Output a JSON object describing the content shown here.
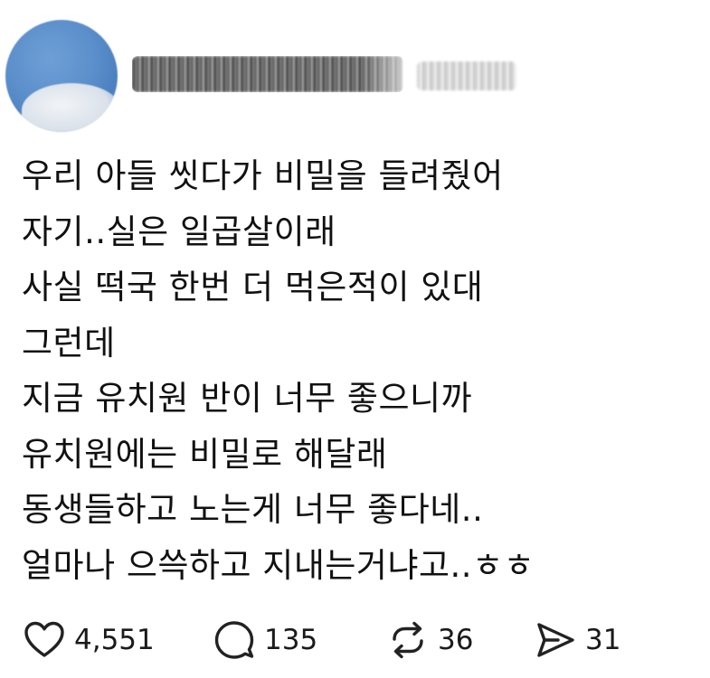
{
  "post": {
    "author": {
      "username": "",
      "avatar": "sky-avatar"
    },
    "lines": [
      "우리 아들 씻다가 비밀을 들려줬어",
      "자기..실은 일곱살이래",
      "사실 떡국 한번 더 먹은적이 있대",
      "그런데",
      "지금 유치원 반이 너무 좋으니까",
      "유치원에는 비밀로 해달래",
      "동생들하고 노는게 너무 좋다네..",
      "얼마나 으쓱하고 지내는거냐고..ㅎㅎ"
    ]
  },
  "actions": {
    "like": {
      "icon": "heart-icon",
      "count": "4,551"
    },
    "comment": {
      "icon": "speech-bubble-icon",
      "count": "135"
    },
    "repost": {
      "icon": "repost-icon",
      "count": "36"
    },
    "share": {
      "icon": "send-icon",
      "count": "31"
    }
  }
}
